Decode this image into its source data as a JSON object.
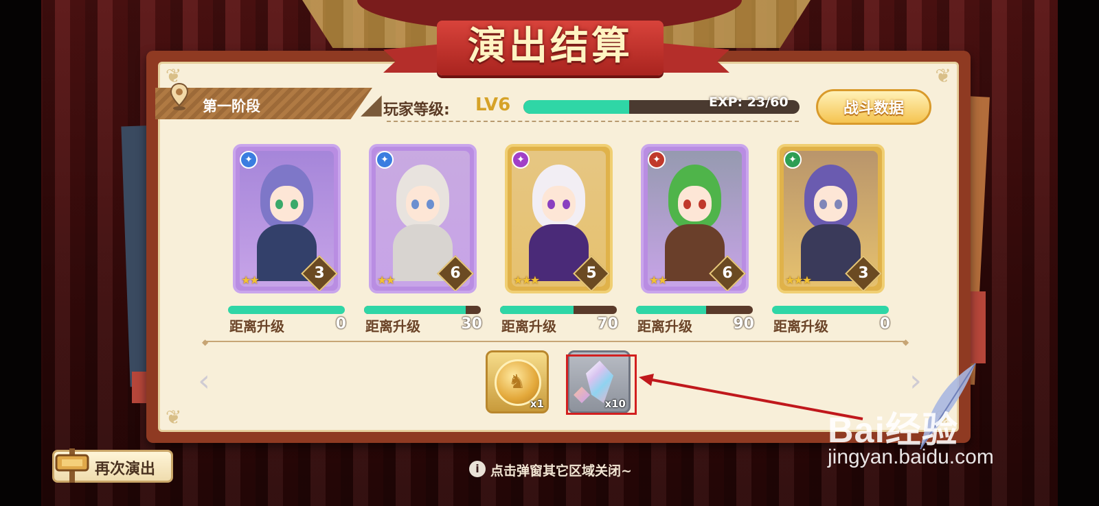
{
  "title": "演出结算",
  "stage": {
    "label": "第一阶段"
  },
  "player": {
    "level_label": "玩家等级:",
    "level_value": "LV6",
    "exp_text": "EXP: 23/60",
    "exp_progress": 0.383
  },
  "battle_data_button": "战斗数据",
  "characters": [
    {
      "element_icon": "wand-icon",
      "element_color": "#3a7de0",
      "stars": "★★",
      "level": "3",
      "frame": "purple",
      "hair_color": "#7e77c8",
      "outfit_color": "#33406a",
      "eye_color": "#3aa96a",
      "upgrade_label": "距离升级",
      "upgrade_value": "0",
      "upgrade_progress": 1.0
    },
    {
      "element_icon": "book-icon",
      "element_color": "#3a7de0",
      "stars": "★★",
      "level": "6",
      "frame": "purple",
      "hair_color": "#e8e3de",
      "outfit_color": "#d8d4d0",
      "eye_color": "#6b8fd0",
      "upgrade_label": "距离升级",
      "upgrade_value": "30",
      "upgrade_progress": 0.87
    },
    {
      "element_icon": "wand-icon",
      "element_color": "#a13fc7",
      "stars": "★★★",
      "level": "5",
      "frame": "gold",
      "hair_color": "#f2eef4",
      "outfit_color": "#4a2a78",
      "eye_color": "#8a3fc0",
      "upgrade_label": "距离升级",
      "upgrade_value": "70",
      "upgrade_progress": 0.63
    },
    {
      "element_icon": "sword-icon",
      "element_color": "#c0392b",
      "stars": "★★",
      "level": "6",
      "frame": "purple",
      "hair_color": "#4fb44a",
      "outfit_color": "#6a3f2a",
      "eye_color": "#c0392b",
      "upgrade_label": "距离升级",
      "upgrade_value": "90",
      "upgrade_progress": 0.6
    },
    {
      "element_icon": "leaf-icon",
      "element_color": "#2e9e54",
      "stars": "★★★",
      "level": "3",
      "frame": "gold",
      "hair_color": "#6a5bb0",
      "outfit_color": "#3a3a5a",
      "eye_color": "#7f86b8",
      "upgrade_label": "距离升级",
      "upgrade_value": "0",
      "upgrade_progress": 1.0
    }
  ],
  "rewards": [
    {
      "icon": "gold-coin-icon",
      "count": "x1"
    },
    {
      "icon": "crystal-icon",
      "count": "x10"
    }
  ],
  "replay_button": "再次演出",
  "hint": "点击弹窗其它区域关闭~",
  "watermark": {
    "line1": "Bai经验",
    "line2": "jingyan.baidu.com"
  },
  "colors": {
    "accent_green": "#2fd6a6",
    "banner_red": "#b42e2a",
    "highlight_red": "#d21f1f"
  }
}
